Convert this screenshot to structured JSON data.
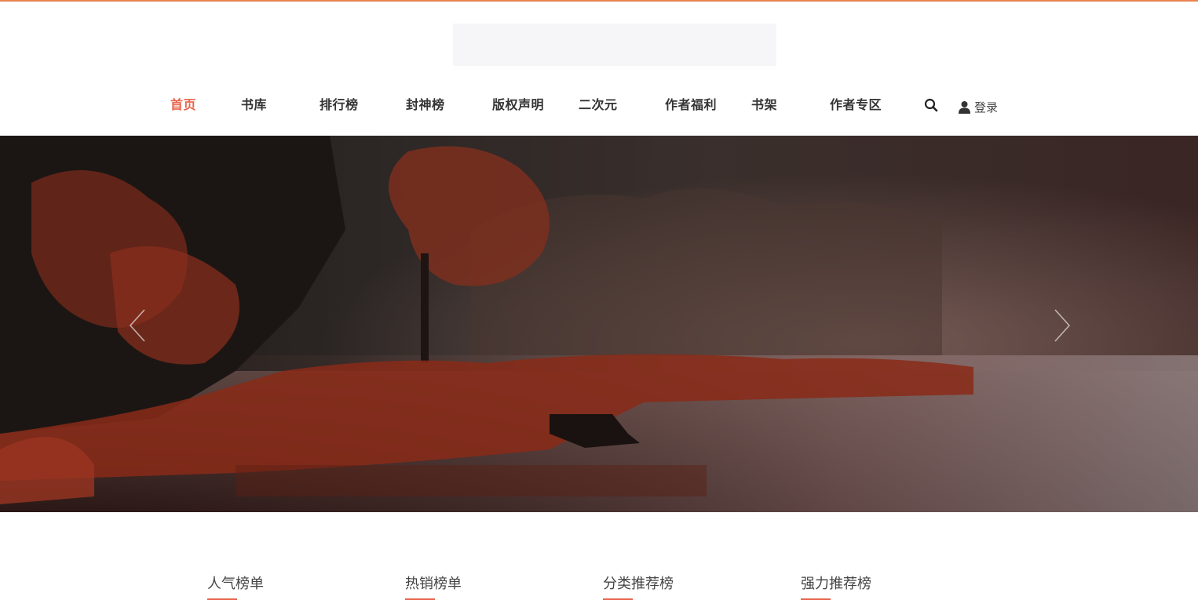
{
  "nav": {
    "items": [
      {
        "label": "首页",
        "active": true
      },
      {
        "label": "书库",
        "active": false
      },
      {
        "label": "排行榜",
        "active": false
      },
      {
        "label": "封神榜",
        "active": false
      },
      {
        "label": "版权声明",
        "active": false
      },
      {
        "label": "二次元",
        "active": false
      },
      {
        "label": "作者福利",
        "active": false
      },
      {
        "label": "书架",
        "active": false
      },
      {
        "label": "作者专区",
        "active": false
      }
    ],
    "search_icon": "search-icon",
    "login_label": "登录",
    "login_icon": "user-icon"
  },
  "banner": {
    "prev_icon": "chevron-left-icon",
    "next_icon": "chevron-right-icon"
  },
  "rank_tabs": [
    {
      "label": "人气榜单"
    },
    {
      "label": "热销榜单"
    },
    {
      "label": "分类推荐榜"
    },
    {
      "label": "强力推荐榜"
    }
  ],
  "colors": {
    "accent": "#e8624a",
    "top_line": "#e8844f",
    "logo_placeholder": "#f6f6f8"
  }
}
